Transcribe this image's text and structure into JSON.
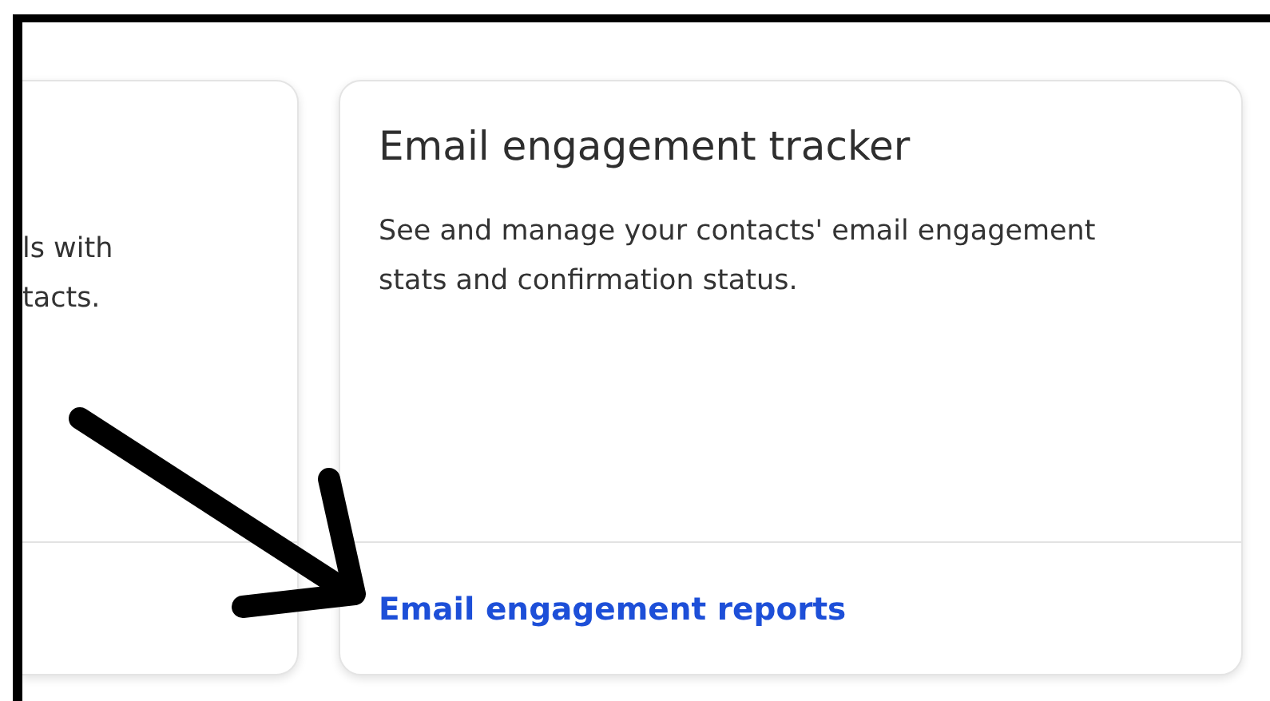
{
  "cards": [
    {
      "description_lines": [
        "ls with",
        "tacts."
      ]
    },
    {
      "title": "Email engagement tracker",
      "description_lines": [
        "See and manage your contacts' email engagement",
        "stats and confirmation status."
      ],
      "link": "Email engagement reports"
    }
  ]
}
